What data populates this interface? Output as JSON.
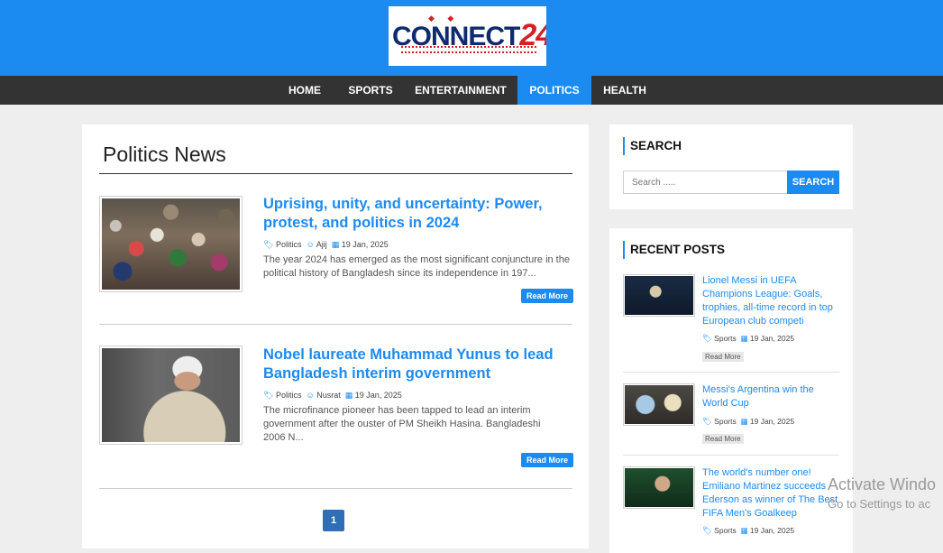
{
  "site": {
    "logo_text": "CONNECT",
    "logo_num": "24",
    "brand_color": "#1b8bf2"
  },
  "nav": {
    "items": [
      {
        "label": "HOME"
      },
      {
        "label": "SPORTS"
      },
      {
        "label": "ENTERTAINMENT"
      },
      {
        "label": "POLITICS",
        "active": true
      },
      {
        "label": "HEALTH"
      }
    ]
  },
  "main": {
    "title": "Politics News",
    "posts": [
      {
        "title": "Uprising, unity, and uncertainty: Power, protest, and politics in 2024",
        "category": "Politics",
        "author": "Ajij",
        "date": "19 Jan, 2025",
        "excerpt": "The year 2024 has emerged as the most significant conjuncture in the political history of Bangladesh since its independence in 197...",
        "read_more": "Read More"
      },
      {
        "title": "Nobel laureate Muhammad Yunus to lead Bangladesh interim government",
        "category": "Politics",
        "author": "Nusrat",
        "date": "19 Jan, 2025",
        "excerpt": "The microfinance pioneer has been tapped to lead an interim government after the ouster of PM Sheikh Hasina. Bangladeshi 2006 N...",
        "read_more": "Read More"
      }
    ],
    "pagination": {
      "current": "1"
    }
  },
  "sidebar": {
    "search": {
      "title": "SEARCH",
      "placeholder": "Search .....",
      "button": "SEARCH"
    },
    "recent": {
      "title": "RECENT POSTS",
      "posts": [
        {
          "title": "Lionel Messi in UEFA Champions League: Goals, trophies, all-time record in top European club competi",
          "category": "Sports",
          "date": "19 Jan, 2025",
          "read_more": "Read More"
        },
        {
          "title": "Messi's Argentina win the World Cup",
          "category": "Sports",
          "date": "19 Jan, 2025",
          "read_more": "Read More"
        },
        {
          "title": "The world's number one! Emiliano Martinez succeeds Ederson as winner of The Best FIFA Men's Goalkeep",
          "category": "Sports",
          "date": "19 Jan, 2025"
        }
      ]
    }
  },
  "overlay": {
    "line1": "Activate Windo",
    "line2": "Go to Settings to ac"
  }
}
